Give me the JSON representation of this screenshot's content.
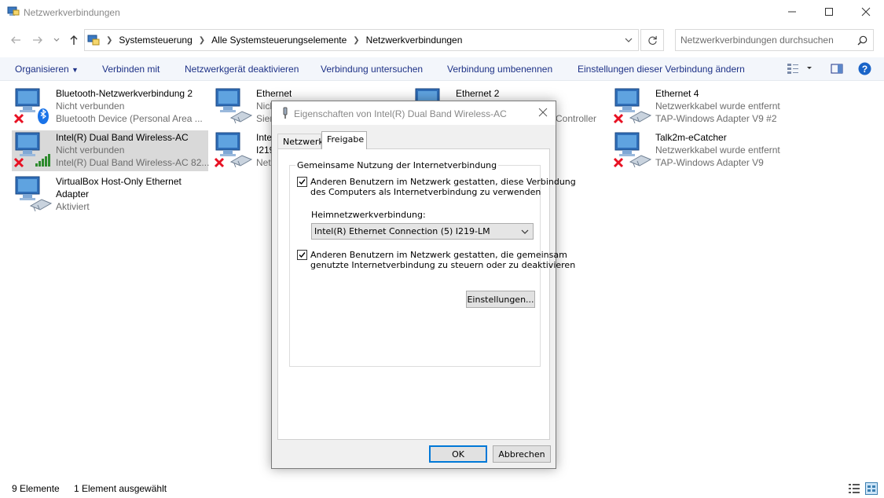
{
  "window": {
    "title": "Netzwerkverbindungen"
  },
  "breadcrumb": [
    "Systemsteuerung",
    "Alle Systemsteuerungselemente",
    "Netzwerkverbindungen"
  ],
  "search": {
    "placeholder": "Netzwerkverbindungen durchsuchen"
  },
  "toolbar": {
    "organize": "Organisieren",
    "items": [
      "Verbinden mit",
      "Netzwerkgerät deaktivieren",
      "Verbindung untersuchen",
      "Verbindung umbenennen",
      "Einstellungen dieser Verbindung ändern"
    ]
  },
  "connections": [
    {
      "name": "Bluetooth-Netzwerkverbindung 2",
      "status": "Nicht verbunden",
      "device": "Bluetooth Device (Personal Area ...",
      "icon": "bluetooth-adapter-icon",
      "state": "disconnected"
    },
    {
      "name": "Ethernet",
      "status": "Nicht ...",
      "device": "Sien...",
      "icon": "ethernet-adapter-icon",
      "state": "normal"
    },
    {
      "name": "Ethernet 2",
      "status": "",
      "device": "Controller",
      "icon": "ethernet-adapter-icon",
      "state": "normal"
    },
    {
      "name": "Ethernet 4",
      "status": "Netzwerkkabel wurde entfernt",
      "device": "TAP-Windows Adapter V9 #2",
      "icon": "ethernet-adapter-icon",
      "state": "disconnected"
    },
    {
      "name": "Intel(R) Dual Band Wireless-AC",
      "status": "Nicht verbunden",
      "device": "Intel(R) Dual Band Wireless-AC 82...",
      "icon": "wifi-adapter-icon",
      "state": "disconnected"
    },
    {
      "name": "Inte...",
      "status": "I219...",
      "device": "Net...",
      "icon": "ethernet-adapter-icon",
      "state": "disconnected"
    },
    {
      "name": "Talk2m-eCatcher",
      "status": "Netzwerkkabel wurde entfernt",
      "device": "TAP-Windows Adapter V9",
      "icon": "ethernet-adapter-icon",
      "state": "disconnected"
    },
    {
      "name": "VirtualBox Host-Only Ethernet",
      "status": "Adapter",
      "device": "Aktiviert",
      "icon": "ethernet-adapter-icon",
      "state": "normal"
    }
  ],
  "statusbar": {
    "count": "9 Elemente",
    "selected": "1 Element ausgewählt"
  },
  "dialog": {
    "title": "Eigenschaften von Intel(R) Dual Band Wireless-AC",
    "tabs": [
      "Netzwerk",
      "Freigabe"
    ],
    "group_title": "Gemeinsame Nutzung der Internetverbindung",
    "checkbox1": {
      "line1": "Anderen Benutzern im Netzwerk gestatten, diese Verbindung",
      "line2": "des Computers als Internetverbindung zu verwenden",
      "checked": true
    },
    "home_label": "Heimnetzwerkverbindung:",
    "home_value": "Intel(R) Ethernet Connection (5) I219-LM",
    "checkbox2": {
      "line1": "Anderen Benutzern im Netzwerk gestatten, die gemeinsam",
      "line2": "genutzte Internetverbindung zu steuern oder zu deaktivieren",
      "checked": true
    },
    "settings_button": "Einstellungen...",
    "ok_button": "OK",
    "cancel_button": "Abbrechen"
  },
  "colors": {
    "link": "#1e3287",
    "selection": "#d9d9d9",
    "toolbar_bg": "#f3f6fb",
    "accent": "#0078d7"
  }
}
